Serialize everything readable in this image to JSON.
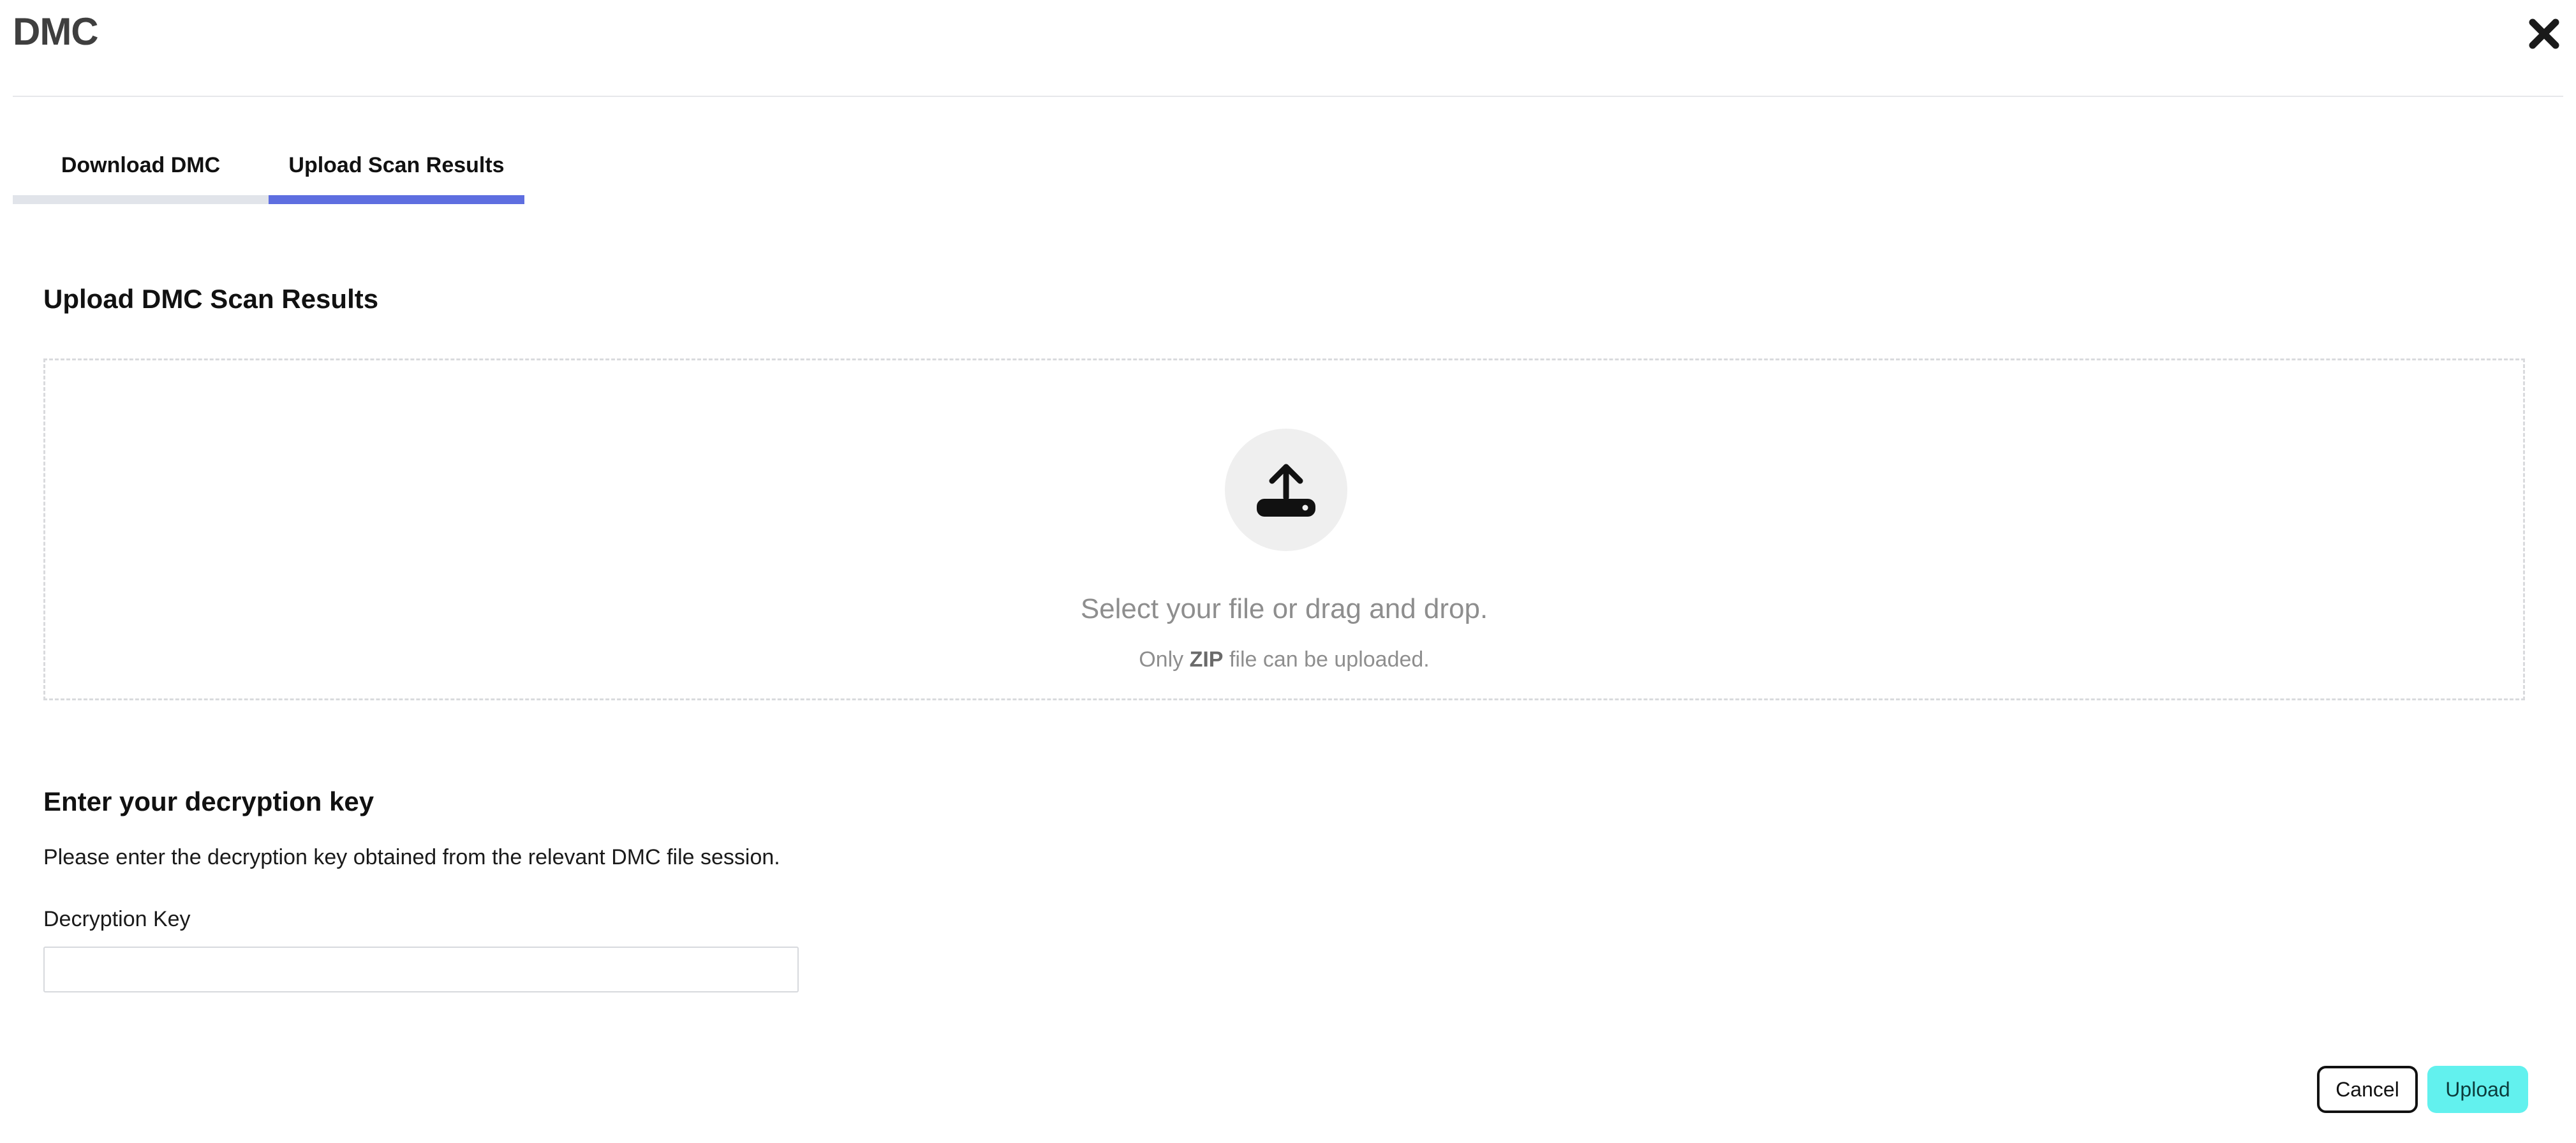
{
  "header": {
    "title": "DMC"
  },
  "tabs": [
    {
      "label": "Download DMC",
      "active": false
    },
    {
      "label": "Upload Scan Results",
      "active": true
    }
  ],
  "upload_section": {
    "heading": "Upload DMC Scan Results",
    "dropzone": {
      "icon": "upload-icon",
      "primary_text": "Select your file or drag and drop.",
      "secondary_prefix": "Only ",
      "secondary_bold": "ZIP",
      "secondary_suffix": " file can be uploaded."
    }
  },
  "decryption_section": {
    "heading": "Enter your decryption key",
    "description": "Please enter the decryption key obtained from the relevant DMC file session.",
    "field_label": "Decryption Key",
    "field_value": ""
  },
  "actions": {
    "cancel_label": "Cancel",
    "upload_label": "Upload"
  },
  "colors": {
    "tab_active": "#5e6ee0",
    "tab_inactive": "#e1e4ea",
    "upload_button": "#62f1ee"
  }
}
